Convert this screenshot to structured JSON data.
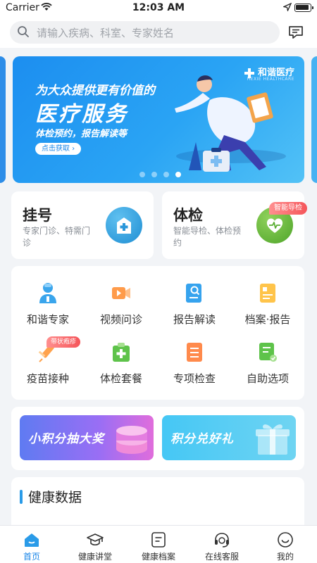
{
  "status_bar": {
    "carrier": "Carrier",
    "time": "12:03 AM"
  },
  "search": {
    "placeholder": "请输入疾病、科室、专家姓名"
  },
  "banner": {
    "brand": "和谐医疗",
    "brand_sub": "HEXIE HEALTHCARE",
    "line1": "为大众提供更有价值的",
    "line2": "医疗服务",
    "line3": "体检预约，报告解读等",
    "cta": "点击获取 ›",
    "pages": 4,
    "active_page": 4
  },
  "quick": [
    {
      "title": "挂号",
      "subtitle": "专家门诊、特需门诊",
      "icon": "hospital-icon"
    },
    {
      "title": "体检",
      "subtitle": "智能导检、体检预约",
      "icon": "heart-icon",
      "badge": "智能导检"
    }
  ],
  "services": [
    {
      "label": "和谐专家",
      "icon": "doctor-icon"
    },
    {
      "label": "视频问诊",
      "icon": "video-icon"
    },
    {
      "label": "报告解读",
      "icon": "report-search-icon"
    },
    {
      "label": "档案·报告",
      "icon": "archive-icon"
    },
    {
      "label": "疫苗接种",
      "icon": "syringe-icon",
      "badge": "带状疱疹"
    },
    {
      "label": "体检套餐",
      "icon": "package-icon"
    },
    {
      "label": "专项检查",
      "icon": "checklist-icon"
    },
    {
      "label": "自助选项",
      "icon": "self-service-icon"
    }
  ],
  "promos": [
    {
      "label": "小积分抽大奖",
      "icon": "coins-icon"
    },
    {
      "label": "积分兑好礼",
      "icon": "gift-icon"
    }
  ],
  "health": {
    "title": "健康数据"
  },
  "tabs": [
    {
      "label": "首页",
      "icon": "home-icon",
      "active": true
    },
    {
      "label": "健康讲堂",
      "icon": "graduation-cap-icon",
      "active": false
    },
    {
      "label": "健康档案",
      "icon": "file-icon",
      "active": false
    },
    {
      "label": "在线客服",
      "icon": "headset-icon",
      "active": false
    },
    {
      "label": "我的",
      "icon": "smile-icon",
      "active": false
    }
  ],
  "colors": {
    "primary": "#1a86e8",
    "badge": "#f5555a",
    "background": "#f2f4f7"
  }
}
